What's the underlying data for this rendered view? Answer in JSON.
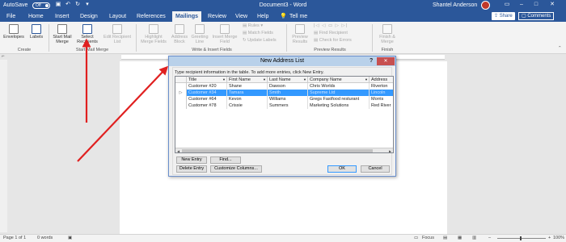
{
  "titlebar": {
    "autosave_label": "AutoSave",
    "autosave_state": "Off",
    "document_title": "Document3 - Word",
    "user_name": "Shantel Anderson",
    "accent_color": "#2b579a"
  },
  "tabs": {
    "items": [
      "File",
      "Home",
      "Insert",
      "Design",
      "Layout",
      "References",
      "Mailings",
      "Review",
      "View",
      "Help"
    ],
    "search_placeholder": "Tell me",
    "share_label": "Share",
    "comments_label": "Comments"
  },
  "ribbon": {
    "create": {
      "envelopes": "Envelopes",
      "labels": "Labels",
      "group_label": "Create"
    },
    "start_mail_merge": {
      "start_mail_merge": "Start Mail Merge",
      "select_recipients": "Select Recipients",
      "edit_recipient_list": "Edit Recipient List",
      "group_label": "Start Mail Merge"
    },
    "write_insert": {
      "highlight_merge_fields": "Highlight Merge Fields",
      "address_block": "Address Block",
      "greeting_line": "Greeting Line",
      "insert_merge_field": "Insert Merge Field",
      "rules": "Rules",
      "match_fields": "Match Fields",
      "update_labels": "Update Labels",
      "group_label": "Write & Insert Fields"
    },
    "preview": {
      "preview_results": "Preview Results",
      "find_recipient": "Find Recipient",
      "check_for_errors": "Check for Errors",
      "group_label": "Preview Results"
    },
    "finish": {
      "finish_merge": "Finish & Merge",
      "group_label": "Finish"
    }
  },
  "dialog": {
    "title": "New Address List",
    "help": "?",
    "instructions": "Type recipient information in the table.  To add more entries, click New Entry.",
    "columns": [
      "Title",
      "First Name",
      "Last Name",
      "Company Name",
      "Address"
    ],
    "rows": [
      [
        "Customer #20",
        "Shane",
        "Dawson",
        "Chris Worlds",
        "Riverton"
      ],
      [
        "Customer #34",
        "Tamara",
        "Smith",
        "Supreme Ltd",
        "Lincoln"
      ],
      [
        "Customer #64",
        "Kevon",
        "Williams",
        "Gregs Fastfood resturant",
        "Morris"
      ],
      [
        "Customer #78",
        "Crissie",
        "Summers",
        "Marketing Solutions",
        "Red River"
      ]
    ],
    "selected_row": 1,
    "buttons": {
      "new_entry": "New Entry",
      "find": "Find...",
      "delete_entry": "Delete Entry",
      "customize_columns": "Customize Columns...",
      "ok": "OK",
      "cancel": "Cancel"
    }
  },
  "statusbar": {
    "page_info": "Page 1 of 1",
    "word_count": "0 words",
    "focus_label": "Focus",
    "zoom": "100%"
  },
  "annotation_color": "#e02020"
}
